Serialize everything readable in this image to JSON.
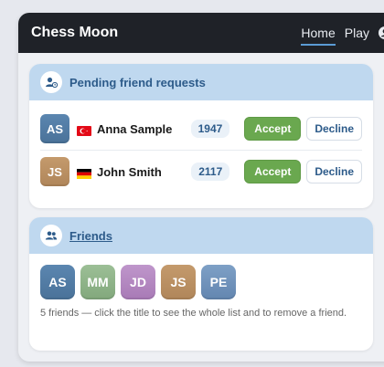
{
  "app": {
    "title": "Chess Moon"
  },
  "nav": {
    "home_label": "Home",
    "play_label": "Play",
    "account_icon": "user-circle-icon"
  },
  "requests": {
    "title": "Pending friend requests",
    "icon": "user-clock-icon",
    "accept_label": "Accept",
    "decline_label": "Decline",
    "items": [
      {
        "initials": "AS",
        "name": "Anna Sample",
        "rating": "1947",
        "flag": "turkey",
        "avatar_color": "#5b86b0"
      },
      {
        "initials": "JS",
        "name": "John Smith",
        "rating": "2117",
        "flag": "germany",
        "avatar_color": "#c49a6c"
      }
    ]
  },
  "friends": {
    "title": "Friends",
    "icon": "users-icon",
    "avatars": [
      {
        "initials": "AS",
        "color": "#5b86b0"
      },
      {
        "initials": "MM",
        "color": "#8fb38a"
      },
      {
        "initials": "JD",
        "color": "#b48cc0"
      },
      {
        "initials": "JS",
        "color": "#c49a6c"
      },
      {
        "initials": "PE",
        "color": "#6f93bd"
      }
    ],
    "hint": "5 friends — click the title to see the whole list and to remove a friend."
  }
}
